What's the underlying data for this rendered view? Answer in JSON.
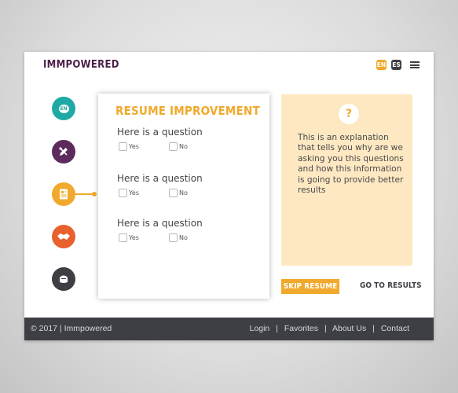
{
  "app": {
    "logo": "IMMPOWERED"
  },
  "header": {
    "lang_en": "EN",
    "lang_es": "ES",
    "menu_icon": "hamburger-menu-icon"
  },
  "steps": [
    {
      "icon": "language-bubble-icon",
      "badge": "EN",
      "color": "#1fa9a4"
    },
    {
      "icon": "pencil-icon",
      "color": "#5c2a5c"
    },
    {
      "icon": "resume-document-icon",
      "color": "#f0a92c",
      "active": true
    },
    {
      "icon": "handshake-icon",
      "color": "#e8602c"
    },
    {
      "icon": "graduation-cap-icon",
      "color": "#3d3f44"
    }
  ],
  "card": {
    "title": "RESUME IMPROVEMENT",
    "questions": [
      {
        "label": "Here is a question",
        "yes": "Yes",
        "no": "No"
      },
      {
        "label": "Here is a question",
        "yes": "Yes",
        "no": "No"
      },
      {
        "label": "Here is a question",
        "yes": "Yes",
        "no": "No"
      }
    ]
  },
  "info": {
    "icon_glyph": "?",
    "text": "This is an explanation that tells you why are we asking you this questions and how this information is going to provide better results"
  },
  "actions": {
    "skip": "SKIP RESUME",
    "results": "GO TO RESULTS"
  },
  "footer": {
    "copyright": "© 2017 | Immpowered",
    "links": [
      "Login",
      "Favorites",
      "About Us",
      "Contact"
    ],
    "separator": "|"
  },
  "colors": {
    "accent": "#f0a92c",
    "brand": "#4a1e48",
    "footer_bg": "#3d3f44",
    "info_bg": "#fde8c2"
  }
}
